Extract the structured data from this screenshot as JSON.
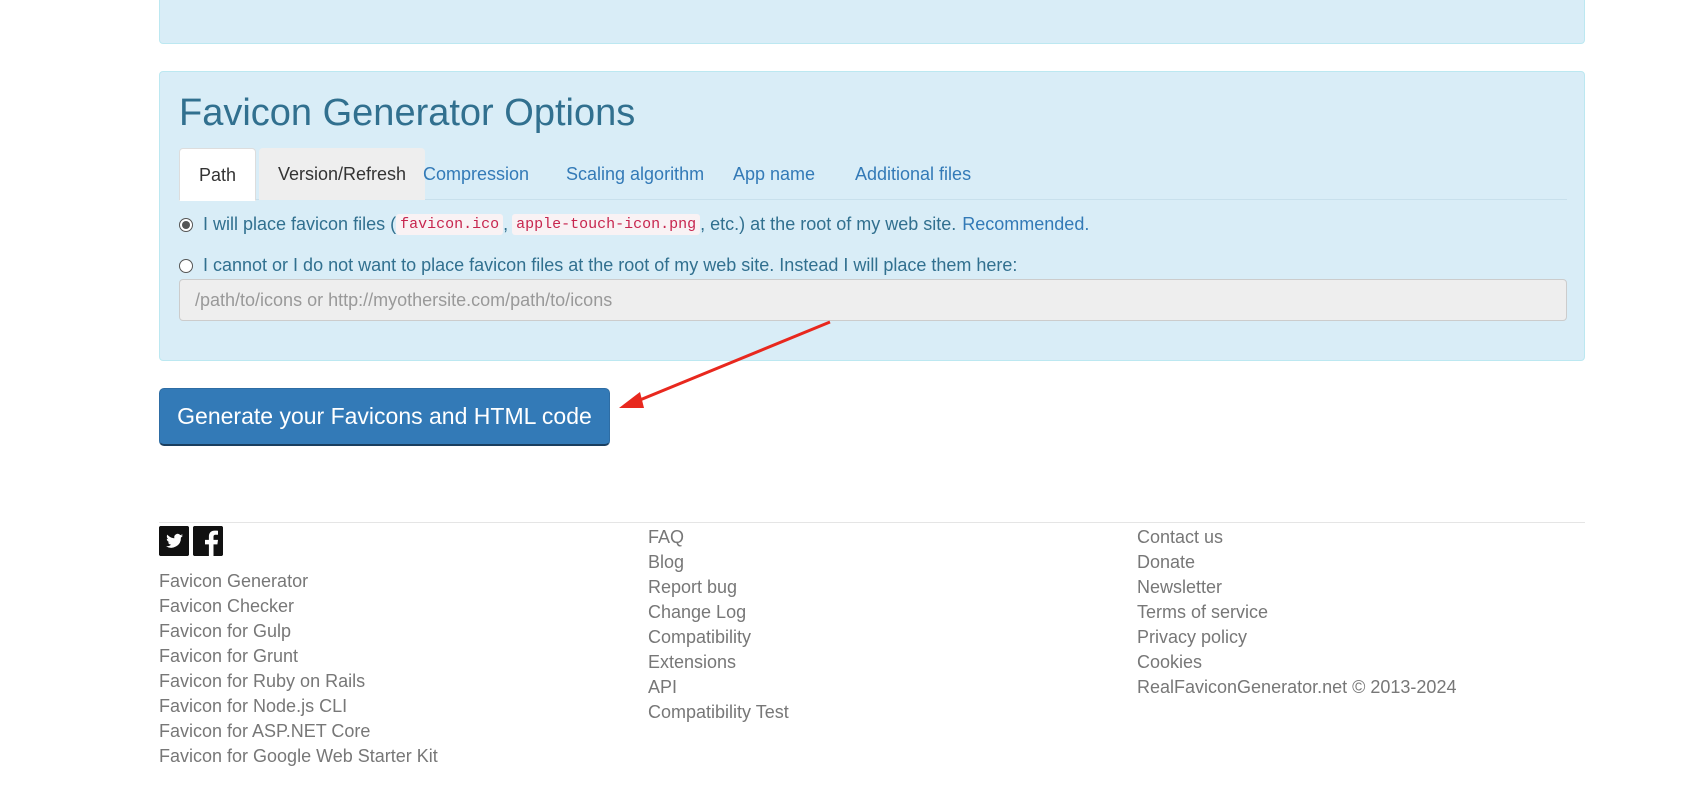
{
  "options": {
    "title": "Favicon Generator Options",
    "tabs": [
      {
        "label": "Path"
      },
      {
        "label": "Version/Refresh"
      },
      {
        "label": "Compression"
      },
      {
        "label": "Scaling algorithm"
      },
      {
        "label": "App name"
      },
      {
        "label": "Additional files"
      }
    ],
    "active_tab": "Path",
    "path_root": {
      "text_before": "I will place favicon files (",
      "file1": "favicon.ico",
      "separator": ",",
      "file2": "apple-touch-icon.png",
      "text_after": ", etc.) at the root of my web site.",
      "recommended": "Recommended.",
      "selected": true
    },
    "path_custom": {
      "text": "I cannot or I do not want to place favicon files at the root of my web site. Instead I will place them here:",
      "selected": false
    },
    "path_input": {
      "value": "",
      "placeholder": "/path/to/icons or http://myothersite.com/path/to/icons"
    }
  },
  "generate_button": {
    "label": "Generate your Favicons and HTML code"
  },
  "annotation": {
    "color": "#e8281e"
  },
  "footer": {
    "social_icons": [
      "twitter-icon",
      "facebook-icon"
    ],
    "col1": [
      "Favicon Generator",
      "Favicon Checker",
      "Favicon for Gulp",
      "Favicon for Grunt",
      "Favicon for Ruby on Rails",
      "Favicon for Node.js CLI",
      "Favicon for ASP.NET Core",
      "Favicon for Google Web Starter Kit"
    ],
    "col2": [
      "FAQ",
      "Blog",
      "Report bug",
      "Change Log",
      "Compatibility",
      "Extensions",
      "API",
      "Compatibility Test"
    ],
    "col3": [
      "Contact us",
      "Donate",
      "Newsletter",
      "Terms of service",
      "Privacy policy",
      "Cookies"
    ],
    "copyright": "RealFaviconGenerator.net © 2013-2024"
  },
  "colors": {
    "panel_bg": "#d9edf7",
    "panel_text": "#31708f",
    "link": "#337ab7",
    "button_bg": "#337ab7"
  }
}
